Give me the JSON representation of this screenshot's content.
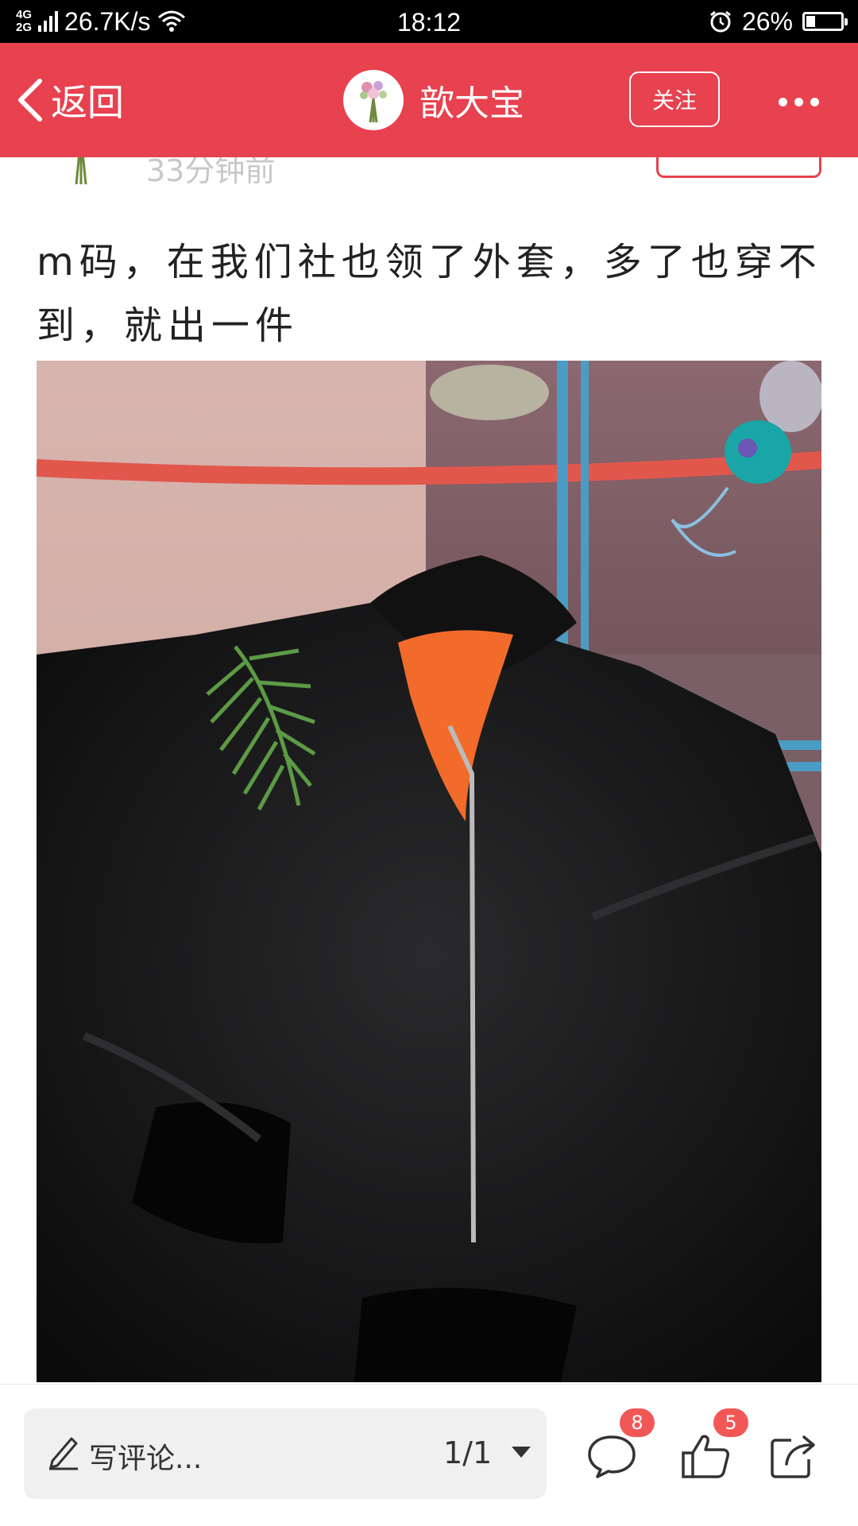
{
  "status_bar": {
    "network_top": "4G",
    "network_bottom": "2G",
    "speed": "26.7K/s",
    "time": "18:12",
    "battery_percent": "26%",
    "battery_level": 0.26
  },
  "header": {
    "back_label": "返回",
    "username": "歆大宝",
    "follow_label": "关注",
    "accent_color": "#e8414f"
  },
  "post": {
    "time_ago": "33分钟前",
    "text_line1": "m码，在我们社也领了外套，多了也穿不",
    "text_line2": "到，就出一件"
  },
  "bottom_bar": {
    "comment_placeholder": "写评论...",
    "page_indicator": "1/1",
    "comment_count": "8",
    "like_count": "5"
  },
  "icons": [
    "back-icon",
    "avatar",
    "more-icon",
    "pencil-icon",
    "dropdown-icon",
    "comment-icon",
    "like-icon",
    "share-icon"
  ]
}
